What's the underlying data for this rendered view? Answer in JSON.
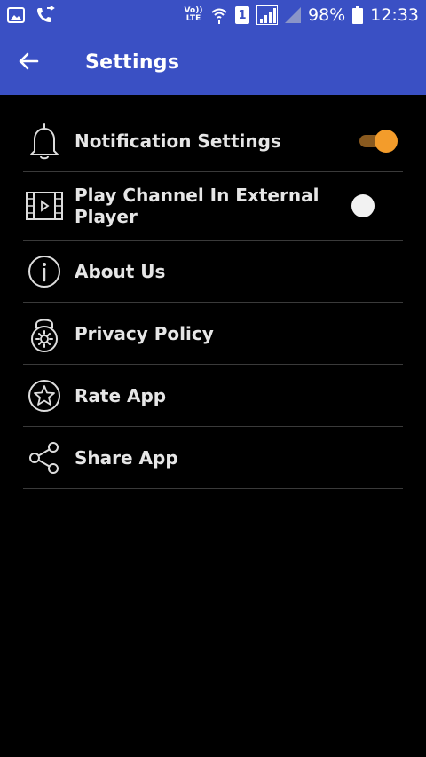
{
  "status_bar": {
    "volte_label": "Vo)) LTE",
    "sim_slot": "1",
    "battery_percent": "98%",
    "time": "12:33"
  },
  "app_bar": {
    "title": "Settings"
  },
  "settings": [
    {
      "label": "Notification Settings",
      "icon": "bell-icon",
      "toggle": true
    },
    {
      "label": "Play Channel In External Player",
      "icon": "video-film-icon",
      "toggle": false
    },
    {
      "label": "About Us",
      "icon": "info-icon"
    },
    {
      "label": "Privacy Policy",
      "icon": "lock-gear-icon"
    },
    {
      "label": "Rate App",
      "icon": "star-circle-icon"
    },
    {
      "label": "Share App",
      "icon": "share-icon"
    }
  ],
  "colors": {
    "app_bar": "#3a50c4",
    "background": "#000000",
    "toggle_on": "#f39c2b",
    "toggle_off": "#f2f2f2"
  }
}
